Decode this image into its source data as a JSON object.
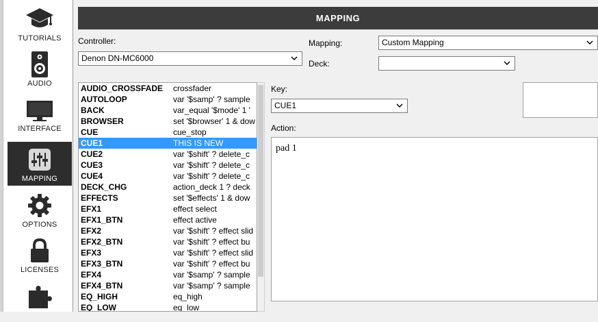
{
  "sidebar": {
    "items": [
      {
        "label": "TUTORIALS",
        "icon": "graduation-cap-icon"
      },
      {
        "label": "AUDIO",
        "icon": "speaker-icon"
      },
      {
        "label": "INTERFACE",
        "icon": "monitor-icon"
      },
      {
        "label": "MAPPING",
        "icon": "sliders-icon",
        "active": true
      },
      {
        "label": "OPTIONS",
        "icon": "gear-icon"
      },
      {
        "label": "LICENSES",
        "icon": "lock-icon"
      },
      {
        "label": "",
        "icon": "puzzle-icon"
      }
    ]
  },
  "header": {
    "title": "MAPPING"
  },
  "controller": {
    "label": "Controller:",
    "value": "Denon DN-MC6000"
  },
  "mapping": {
    "label": "Mapping:",
    "value": "Custom Mapping"
  },
  "deck": {
    "label": "Deck:",
    "value": ""
  },
  "key": {
    "label": "Key:",
    "value": "CUE1"
  },
  "action": {
    "label": "Action:",
    "value": "pad 1"
  },
  "list": {
    "rows": [
      {
        "key": "AUDIO_CROSSFADE",
        "action": "crossfader"
      },
      {
        "key": "AUTOLOOP",
        "action": "var '$samp' ? sample"
      },
      {
        "key": "BACK",
        "action": "var_equal '$mode' 1 '"
      },
      {
        "key": "BROWSER",
        "action": "set '$browser' 1 & dow"
      },
      {
        "key": "CUE",
        "action": "cue_stop"
      },
      {
        "key": "CUE1",
        "action": "THIS IS NEW",
        "selected": true
      },
      {
        "key": "CUE2",
        "action": "var '$shift' ? delete_c"
      },
      {
        "key": "CUE3",
        "action": "var '$shift' ? delete_c"
      },
      {
        "key": "CUE4",
        "action": "var '$shift' ? delete_c"
      },
      {
        "key": "DECK_CHG",
        "action": "action_deck 1 ? deck"
      },
      {
        "key": "EFFECTS",
        "action": "set '$effects' 1 & dow"
      },
      {
        "key": "EFX1",
        "action": "effect select"
      },
      {
        "key": "EFX1_BTN",
        "action": "effect active"
      },
      {
        "key": "EFX2",
        "action": "var '$shift' ? effect slid"
      },
      {
        "key": "EFX2_BTN",
        "action": "var '$shift' ? effect bu"
      },
      {
        "key": "EFX3",
        "action": "var '$shift' ? effect slid"
      },
      {
        "key": "EFX3_BTN",
        "action": "var '$shift' ? effect bu"
      },
      {
        "key": "EFX4",
        "action": "var '$samp' ? sample"
      },
      {
        "key": "EFX4_BTN",
        "action": "var '$samp' ? sample"
      },
      {
        "key": "EQ_HIGH",
        "action": "eq_high"
      },
      {
        "key": "EQ_LOW",
        "action": "eq_low"
      }
    ]
  },
  "colors": {
    "selection": "#3399ff",
    "titlebar": "#3c3c3c",
    "sidebar_active": "#2d2d2d"
  }
}
